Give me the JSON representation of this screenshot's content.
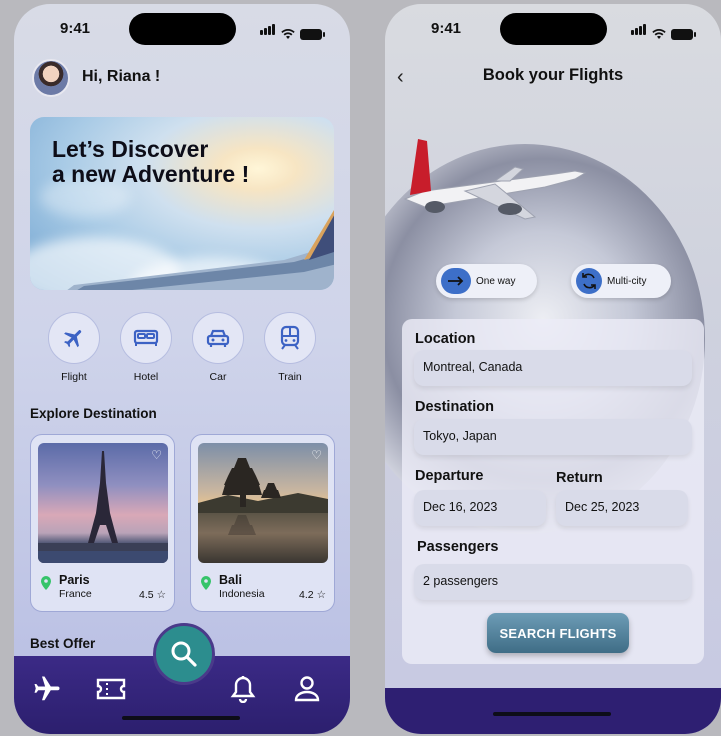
{
  "status": {
    "time": "9:41"
  },
  "home": {
    "greeting": "Hi, Riana !",
    "hero_line1": "Let’s Discover",
    "hero_line2": "a new Adventure !",
    "categories": [
      {
        "label": "Flight",
        "icon": "airplane-icon"
      },
      {
        "label": "Hotel",
        "icon": "bed-icon"
      },
      {
        "label": "Car",
        "icon": "car-icon"
      },
      {
        "label": "Train",
        "icon": "train-icon"
      }
    ],
    "explore_title": "Explore Destination",
    "destinations": [
      {
        "name": "Paris",
        "country": "France",
        "rating": "4.5"
      },
      {
        "name": "Bali",
        "country": "Indonesia",
        "rating": "4.2"
      }
    ],
    "best_offer_title": "Best Offer",
    "nav": [
      "airplane-icon",
      "ticket-icon",
      "search-icon",
      "bell-icon",
      "user-icon"
    ]
  },
  "booking": {
    "title": "Book your Flights",
    "trip_types": {
      "one_way": "One way",
      "multi_city": "Multi-city"
    },
    "location_label": "Location",
    "location_value": "Montreal, Canada",
    "destination_label": "Destination",
    "destination_value": "Tokyo, Japan",
    "departure_label": "Departure",
    "departure_value": "Dec 16, 2023",
    "return_label": "Return",
    "return_value": "Dec 25, 2023",
    "passengers_label": "Passengers",
    "passengers_value": "2 passengers",
    "search_button": "SEARCH FLIGHTS"
  },
  "colors": {
    "accent": "#2c8d8e",
    "nav": "#2e1f72",
    "button": "#4f7f98"
  }
}
